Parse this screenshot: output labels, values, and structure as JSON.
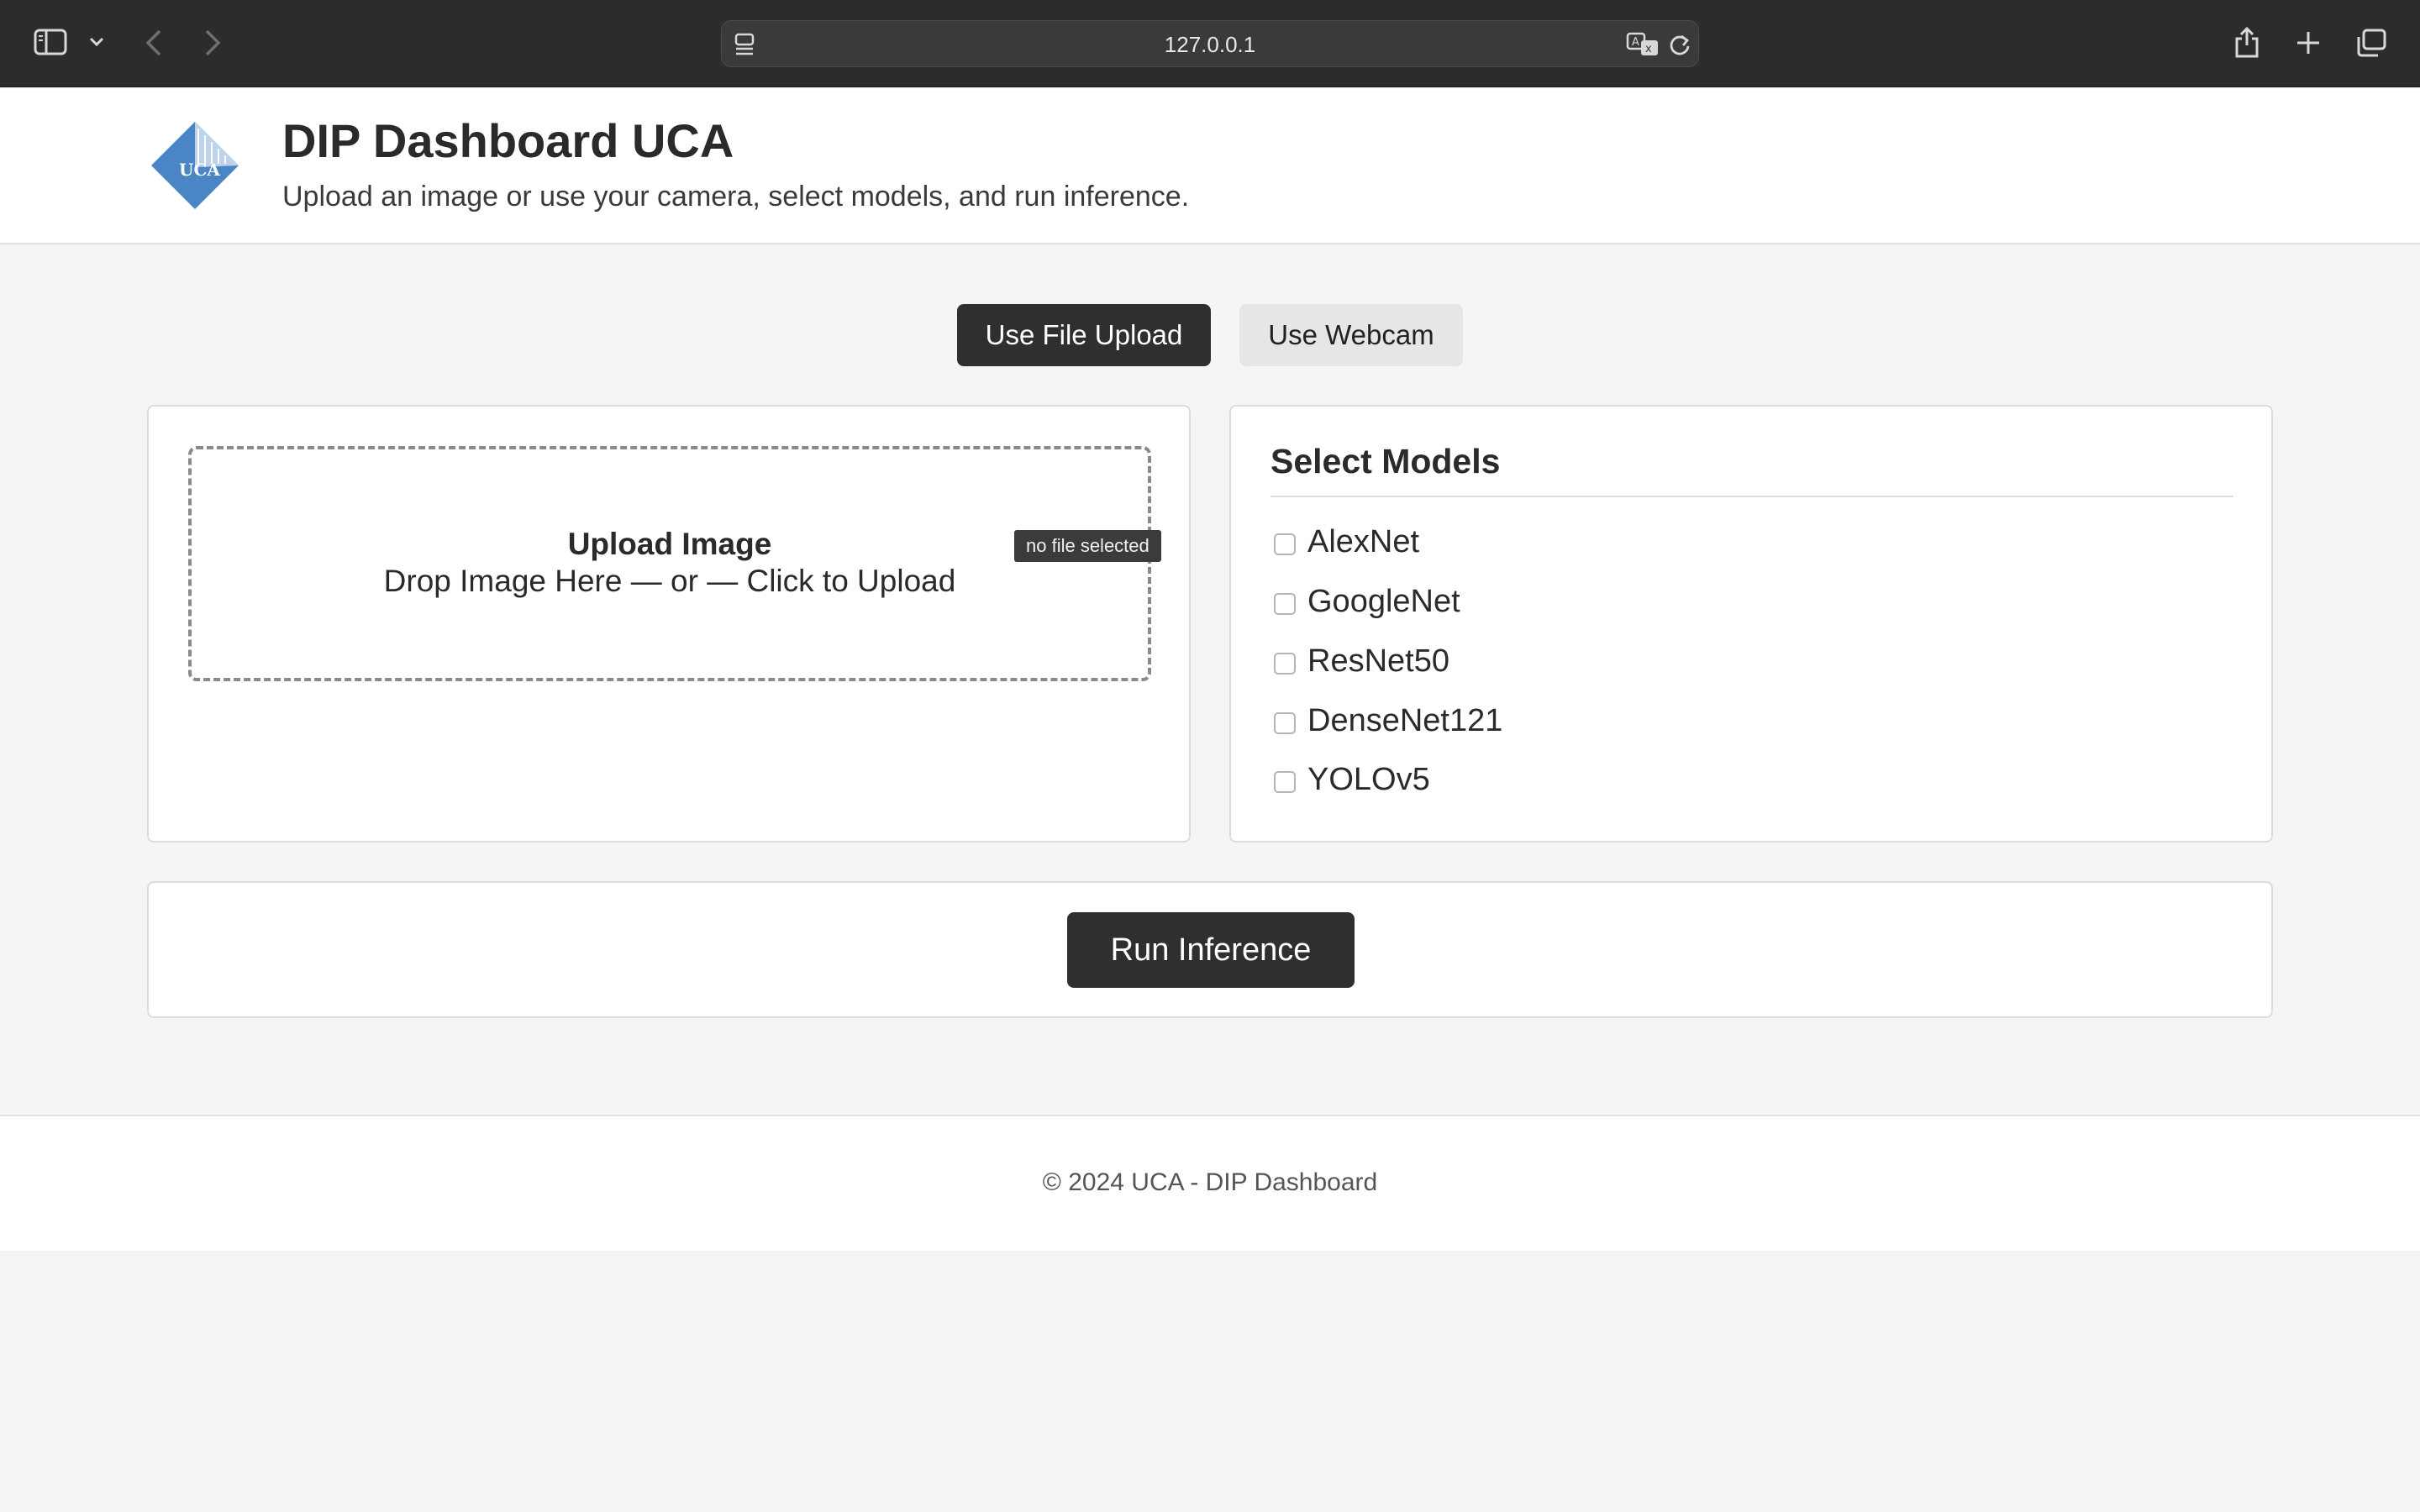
{
  "browser": {
    "url": "127.0.0.1",
    "icons": [
      "sidebar-icon",
      "chevron-down-icon",
      "back-icon",
      "forward-icon",
      "page-menu-icon",
      "translate-icon",
      "reload-icon",
      "share-icon",
      "new-tab-icon",
      "tab-overview-icon"
    ]
  },
  "header": {
    "logo_text": "UCA",
    "title": "DIP Dashboard UCA",
    "subtitle": "Upload an image or use your camera, select models, and run inference."
  },
  "mode": {
    "file_upload_label": "Use File Upload",
    "webcam_label": "Use Webcam",
    "selected": "Use File Upload"
  },
  "upload": {
    "title": "Upload Image",
    "subtitle": "Drop Image Here — or — Click to Upload",
    "file_status": "no file selected"
  },
  "models": {
    "heading": "Select Models",
    "items": [
      {
        "label": "AlexNet",
        "checked": false
      },
      {
        "label": "GoogleNet",
        "checked": false
      },
      {
        "label": "ResNet50",
        "checked": false
      },
      {
        "label": "DenseNet121",
        "checked": false
      },
      {
        "label": "YOLOv5",
        "checked": false
      }
    ]
  },
  "run": {
    "label": "Run Inference"
  },
  "footer": {
    "text": "© 2024 UCA - DIP Dashboard"
  },
  "colors": {
    "chrome_bg": "#2c2c2e",
    "page_bg": "#f5f5f5",
    "primary_button": "#2f2f2f",
    "secondary_button": "#e6e6e6",
    "logo_blue": "#4a86c5"
  }
}
